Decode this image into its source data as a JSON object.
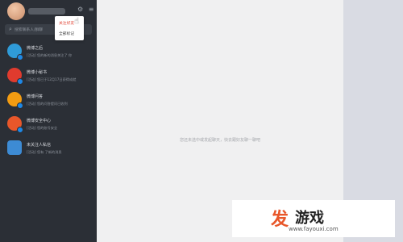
{
  "header": {
    "top_icons": "⚙ ≡"
  },
  "search": {
    "icon": "search-icon",
    "placeholder": "搜索联系人/群聊"
  },
  "dropdown": {
    "items": [
      {
        "label": "关注好友"
      },
      {
        "label": "全部标记"
      }
    ]
  },
  "conversations": [
    {
      "title": "微博之后",
      "snippet": "[活动] 您的新的消息关注了 你",
      "avatar_color": "#2f9bd8",
      "icon": "weibo-icon"
    },
    {
      "title": "微博小秘书",
      "snippet": "[活动] 您已于12月17日获得成就",
      "avatar_color": "#e03b2e",
      "icon": "weibo-icon"
    },
    {
      "title": "微博问答",
      "snippet": "[活动] 您的问答提问已收到",
      "avatar_color": "#f39c12",
      "icon": "question-icon"
    },
    {
      "title": "微博安全中心",
      "snippet": "[活动] 您的账号安全",
      "avatar_color": "#e8572a",
      "icon": "shield-icon"
    },
    {
      "title": "未关注人私信",
      "snippet": "[活动] 您有 了新的消息",
      "avatar_color": "#3d8bd4",
      "icon": "mail-icon"
    }
  ],
  "main": {
    "empty_text": "您还未选中或发起聊天，快去跟好友聊一聊吧"
  },
  "watermark": {
    "logo_char": "发",
    "title": "游戏",
    "url": "www.fayouxi.com"
  },
  "colors": {
    "sidebar_bg": "#2b2f36",
    "main_bg": "#f0f0f1",
    "accent_red": "#e24a3b"
  }
}
